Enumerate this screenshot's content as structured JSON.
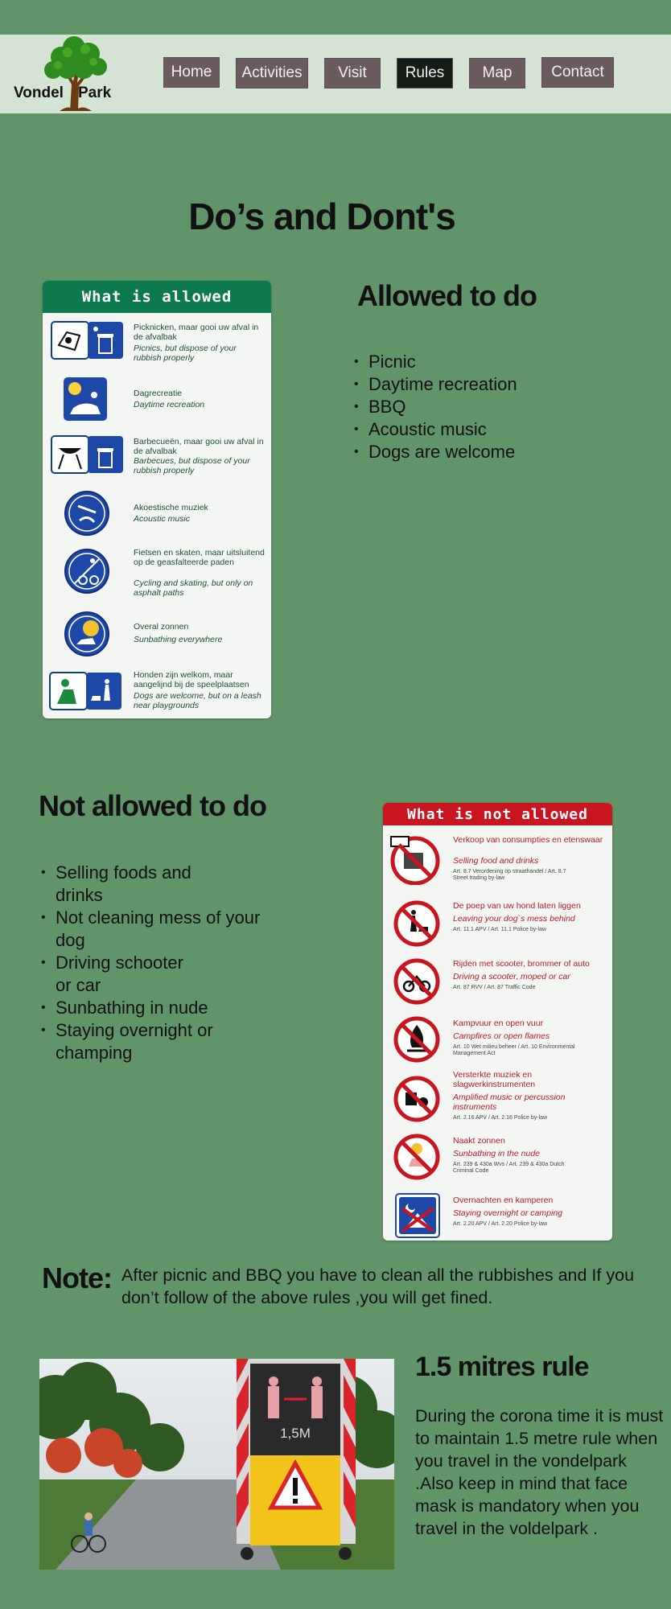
{
  "logo": {
    "word1": "Vondel",
    "word2": "Park"
  },
  "nav": [
    {
      "label": "Home"
    },
    {
      "label": "Activities"
    },
    {
      "label": "Visit"
    },
    {
      "label": "Rules",
      "active": true
    },
    {
      "label": "Map"
    },
    {
      "label": "Contact"
    }
  ],
  "page_title": "Do’s and Dont's",
  "allowed": {
    "heading": "Allowed to do",
    "items": [
      "Picnic",
      "Daytime recreation",
      "BBQ",
      "Acoustic music",
      "Dogs are  welcome"
    ],
    "sign": {
      "header": "What is allowed",
      "color": "#0d7a4e",
      "rows": [
        {
          "nl": "Picknicken, maar gooi uw afval in de afvalbak",
          "en": "Picnics, but dispose of your rubbish properly",
          "icon": "picnic-icon"
        },
        {
          "nl": "Dagrecreatie",
          "en": "Daytime recreation",
          "icon": "recreation-icon"
        },
        {
          "nl": "Barbecueën, maar gooi uw afval in de afvalbak",
          "en": "Barbecues, but dispose of your rubbish properly",
          "icon": "bbq-icon"
        },
        {
          "nl": "Akoestische muziek",
          "en": "Acoustic music",
          "icon": "music-icon"
        },
        {
          "nl": "Fietsen en skaten, maar uitsluitend op de geasfalteerde paden",
          "en": "Cycling and skating, but only on asphalt paths",
          "icon": "cycling-icon"
        },
        {
          "nl": "Overal zonnen",
          "en": "Sunbathing everywhere",
          "icon": "sunbathing-icon"
        },
        {
          "nl": "Honden zijn welkom, maar aangelijnd bij de speelplaatsen",
          "en": "Dogs are welcome, but on a leash near playgrounds",
          "icon": "dog-icon"
        }
      ]
    }
  },
  "not_allowed": {
    "heading": "Not allowed to do",
    "items": [
      "Selling foods and drinks",
      "Not cleaning mess of your dog",
      "Driving schooter or car",
      "Sunbathing in nude",
      "Staying overnight or champing"
    ],
    "sign": {
      "header": "What is not allowed",
      "color": "#c8151f",
      "rows": [
        {
          "nl": "Verkoop van consumpties en etenswaar",
          "en": "Selling food and drinks",
          "law": "Art. 8.7 Verordening op straathandel / Art. 8.7 Street trading by-law",
          "icon": "no-selling-icon"
        },
        {
          "nl": "De poep van uw hond laten liggen",
          "en": "Leaving your dog`s mess behind",
          "law": "Art. 11.1 APV / Art. 11.1 Police by-law",
          "icon": "no-dog-mess-icon"
        },
        {
          "nl": "Rijden met scooter, brommer of auto",
          "en": "Driving a scooter, moped or car",
          "law": "Art. 87 RVV / Art. 87 Traffic Code",
          "icon": "no-scooter-icon"
        },
        {
          "nl": "Kampvuur en open vuur",
          "en": "Campfires or open flames",
          "law": "Art. 10 Wet milieu beheer / Art. 10 Environmental Management Act",
          "icon": "no-fire-icon"
        },
        {
          "nl": "Versterkte muziek en slagwerkinstrumenten",
          "en": "Amplified music or percussion instruments",
          "law": "Art. 2.16 APV / Art. 2.16 Police by-law",
          "icon": "no-amplified-music-icon"
        },
        {
          "nl": "Naakt zonnen",
          "en": "Sunbathing in the nude",
          "law": "Art. 239 & 430a Wvs / Art. 239 & 430a Dutch Criminal Code",
          "icon": "no-nude-icon"
        },
        {
          "nl": "Overnachten en kamperen",
          "en": "Staying overnight or camping",
          "law": "Art. 2.20 APV / Art. 2.20 Police by-law",
          "icon": "no-camping-icon"
        }
      ]
    }
  },
  "note": {
    "label": "Note:",
    "text": "After picnic and BBQ you have to clean  all the rubbishes and If you don’t follow of the above rules ,you will get fined."
  },
  "distance_rule": {
    "heading": "1.5 mitres rule",
    "text": "During the corona time it is must to maintain 1.5 metre rule when you travel in the vondelpark .Also keep in mind that face mask is mandatory when you travel in the voldelpark .",
    "sign_display": "1,5M"
  }
}
